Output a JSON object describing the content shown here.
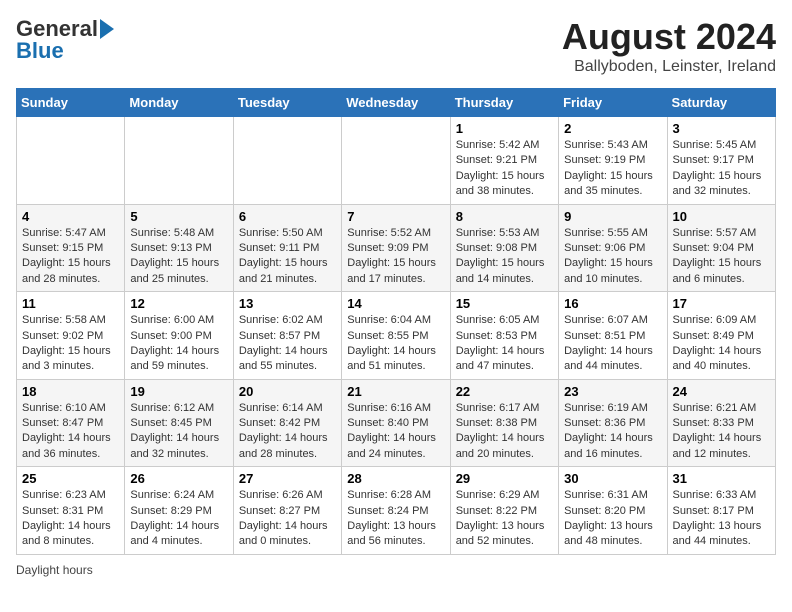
{
  "header": {
    "logo_general": "General",
    "logo_blue": "Blue",
    "title": "August 2024",
    "subtitle": "Ballyboden, Leinster, Ireland"
  },
  "days_of_week": [
    "Sunday",
    "Monday",
    "Tuesday",
    "Wednesday",
    "Thursday",
    "Friday",
    "Saturday"
  ],
  "weeks": [
    [
      {
        "day": "",
        "info": ""
      },
      {
        "day": "",
        "info": ""
      },
      {
        "day": "",
        "info": ""
      },
      {
        "day": "",
        "info": ""
      },
      {
        "day": "1",
        "info": "Sunrise: 5:42 AM\nSunset: 9:21 PM\nDaylight: 15 hours\nand 38 minutes."
      },
      {
        "day": "2",
        "info": "Sunrise: 5:43 AM\nSunset: 9:19 PM\nDaylight: 15 hours\nand 35 minutes."
      },
      {
        "day": "3",
        "info": "Sunrise: 5:45 AM\nSunset: 9:17 PM\nDaylight: 15 hours\nand 32 minutes."
      }
    ],
    [
      {
        "day": "4",
        "info": "Sunrise: 5:47 AM\nSunset: 9:15 PM\nDaylight: 15 hours\nand 28 minutes."
      },
      {
        "day": "5",
        "info": "Sunrise: 5:48 AM\nSunset: 9:13 PM\nDaylight: 15 hours\nand 25 minutes."
      },
      {
        "day": "6",
        "info": "Sunrise: 5:50 AM\nSunset: 9:11 PM\nDaylight: 15 hours\nand 21 minutes."
      },
      {
        "day": "7",
        "info": "Sunrise: 5:52 AM\nSunset: 9:09 PM\nDaylight: 15 hours\nand 17 minutes."
      },
      {
        "day": "8",
        "info": "Sunrise: 5:53 AM\nSunset: 9:08 PM\nDaylight: 15 hours\nand 14 minutes."
      },
      {
        "day": "9",
        "info": "Sunrise: 5:55 AM\nSunset: 9:06 PM\nDaylight: 15 hours\nand 10 minutes."
      },
      {
        "day": "10",
        "info": "Sunrise: 5:57 AM\nSunset: 9:04 PM\nDaylight: 15 hours\nand 6 minutes."
      }
    ],
    [
      {
        "day": "11",
        "info": "Sunrise: 5:58 AM\nSunset: 9:02 PM\nDaylight: 15 hours\nand 3 minutes."
      },
      {
        "day": "12",
        "info": "Sunrise: 6:00 AM\nSunset: 9:00 PM\nDaylight: 14 hours\nand 59 minutes."
      },
      {
        "day": "13",
        "info": "Sunrise: 6:02 AM\nSunset: 8:57 PM\nDaylight: 14 hours\nand 55 minutes."
      },
      {
        "day": "14",
        "info": "Sunrise: 6:04 AM\nSunset: 8:55 PM\nDaylight: 14 hours\nand 51 minutes."
      },
      {
        "day": "15",
        "info": "Sunrise: 6:05 AM\nSunset: 8:53 PM\nDaylight: 14 hours\nand 47 minutes."
      },
      {
        "day": "16",
        "info": "Sunrise: 6:07 AM\nSunset: 8:51 PM\nDaylight: 14 hours\nand 44 minutes."
      },
      {
        "day": "17",
        "info": "Sunrise: 6:09 AM\nSunset: 8:49 PM\nDaylight: 14 hours\nand 40 minutes."
      }
    ],
    [
      {
        "day": "18",
        "info": "Sunrise: 6:10 AM\nSunset: 8:47 PM\nDaylight: 14 hours\nand 36 minutes."
      },
      {
        "day": "19",
        "info": "Sunrise: 6:12 AM\nSunset: 8:45 PM\nDaylight: 14 hours\nand 32 minutes."
      },
      {
        "day": "20",
        "info": "Sunrise: 6:14 AM\nSunset: 8:42 PM\nDaylight: 14 hours\nand 28 minutes."
      },
      {
        "day": "21",
        "info": "Sunrise: 6:16 AM\nSunset: 8:40 PM\nDaylight: 14 hours\nand 24 minutes."
      },
      {
        "day": "22",
        "info": "Sunrise: 6:17 AM\nSunset: 8:38 PM\nDaylight: 14 hours\nand 20 minutes."
      },
      {
        "day": "23",
        "info": "Sunrise: 6:19 AM\nSunset: 8:36 PM\nDaylight: 14 hours\nand 16 minutes."
      },
      {
        "day": "24",
        "info": "Sunrise: 6:21 AM\nSunset: 8:33 PM\nDaylight: 14 hours\nand 12 minutes."
      }
    ],
    [
      {
        "day": "25",
        "info": "Sunrise: 6:23 AM\nSunset: 8:31 PM\nDaylight: 14 hours\nand 8 minutes."
      },
      {
        "day": "26",
        "info": "Sunrise: 6:24 AM\nSunset: 8:29 PM\nDaylight: 14 hours\nand 4 minutes."
      },
      {
        "day": "27",
        "info": "Sunrise: 6:26 AM\nSunset: 8:27 PM\nDaylight: 14 hours\nand 0 minutes."
      },
      {
        "day": "28",
        "info": "Sunrise: 6:28 AM\nSunset: 8:24 PM\nDaylight: 13 hours\nand 56 minutes."
      },
      {
        "day": "29",
        "info": "Sunrise: 6:29 AM\nSunset: 8:22 PM\nDaylight: 13 hours\nand 52 minutes."
      },
      {
        "day": "30",
        "info": "Sunrise: 6:31 AM\nSunset: 8:20 PM\nDaylight: 13 hours\nand 48 minutes."
      },
      {
        "day": "31",
        "info": "Sunrise: 6:33 AM\nSunset: 8:17 PM\nDaylight: 13 hours\nand 44 minutes."
      }
    ]
  ],
  "footer": "Daylight hours"
}
